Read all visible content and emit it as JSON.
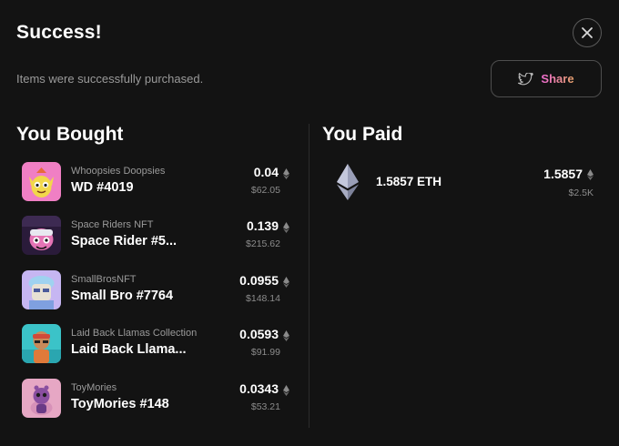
{
  "modal": {
    "title": "Success!",
    "subtitle": "Items were successfully purchased.",
    "share_label": "Share",
    "close_icon": "close-icon",
    "share_icon": "twitter-bird-icon",
    "accent_gradient": [
      "#f06bd4",
      "#e7a36b"
    ]
  },
  "bought": {
    "title": "You Bought",
    "items": [
      {
        "collection": "Whoopsies Doopsies",
        "name": "WD #4019",
        "price": "0.04",
        "usd": "$62.05",
        "thumb_color": "#f07fc4"
      },
      {
        "collection": "Space Riders NFT",
        "name": "Space Rider #5...",
        "price": "0.139",
        "usd": "$215.62",
        "thumb_color": "#2a1b3a"
      },
      {
        "collection": "SmallBrosNFT",
        "name": "Small Bro #7764",
        "price": "0.0955",
        "usd": "$148.14",
        "thumb_color": "#c6b6f2"
      },
      {
        "collection": "Laid Back Llamas Collection",
        "name": "Laid Back Llama...",
        "price": "0.0593",
        "usd": "$91.99",
        "thumb_color": "#3bc3c8"
      },
      {
        "collection": "ToyMories",
        "name": "ToyMories #148",
        "price": "0.0343",
        "usd": "$53.21",
        "thumb_color": "#e6a7c4"
      }
    ]
  },
  "paid": {
    "title": "You Paid",
    "label": "1.5857 ETH",
    "price": "1.5857",
    "usd": "$2.5K",
    "icon": "ethereum-icon"
  }
}
